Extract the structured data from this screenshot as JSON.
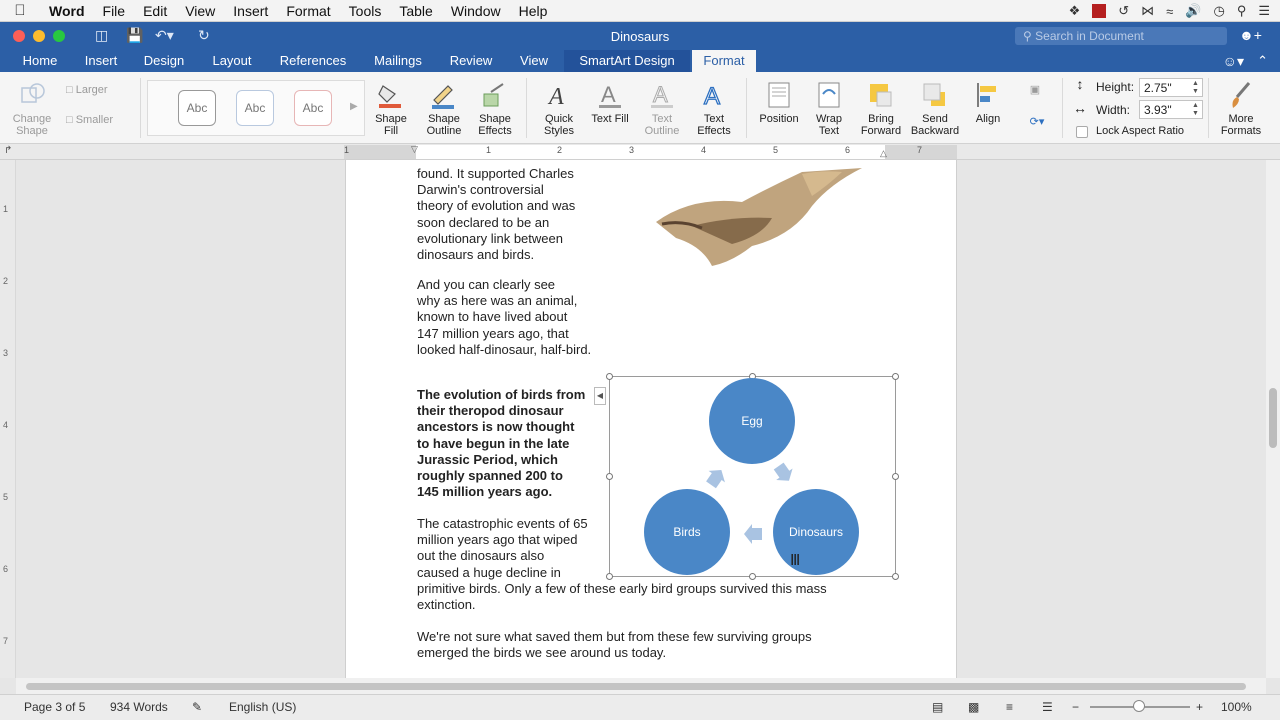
{
  "menubar": {
    "items": [
      "Word",
      "File",
      "Edit",
      "View",
      "Insert",
      "Format",
      "Tools",
      "Table",
      "Window",
      "Help"
    ]
  },
  "window": {
    "title": "Dinosaurs",
    "search_placeholder": "Search in Document"
  },
  "ribbon_tabs": [
    "Home",
    "Insert",
    "Design",
    "Layout",
    "References",
    "Mailings",
    "Review",
    "View",
    "SmartArt Design",
    "Format"
  ],
  "ribbon": {
    "larger": "Larger",
    "smaller": "Smaller",
    "change_shape": "Change Shape",
    "style_sample": "Abc",
    "shape_fill": "Shape Fill",
    "shape_outline": "Shape Outline",
    "shape_effects": "Shape Effects",
    "quick_styles": "Quick Styles",
    "text_fill": "Text Fill",
    "text_outline": "Text Outline",
    "text_effects": "Text Effects",
    "position": "Position",
    "wrap_text": "Wrap Text",
    "bring_forward": "Bring Forward",
    "send_backward": "Send Backward",
    "align": "Align",
    "height_label": "Height:",
    "height_value": "2.75\"",
    "width_label": "Width:",
    "width_value": "3.93\"",
    "lock_aspect": "Lock Aspect Ratio",
    "more_formats": "More Formats"
  },
  "ruler_numbers": [
    "1",
    "1",
    "2",
    "3",
    "4",
    "5",
    "6",
    "7"
  ],
  "vruler_numbers": [
    "1",
    "2",
    "3",
    "4",
    "5",
    "6",
    "7"
  ],
  "document": {
    "para1": "found. It supported Charles\nDarwin's controversial\ntheory of evolution and was\nsoon declared to be an\nevolutionary link between\ndinosaurs and birds.",
    "para2": "And you can clearly see\nwhy as here was an animal,\nknown to have lived about\n147 million years ago, that\nlooked half-dinosaur, half-bird.",
    "para3": "The evolution of birds from\ntheir theropod dinosaur\nancestors is now thought\nto have begun in the late\nJurassic Period, which\nroughly spanned 200 to\n145 million years ago.",
    "para4a": "The catastrophic events of 65\nmillion years ago that wiped\nout the dinosaurs also\ncaused a huge decline in",
    "para4b": "primitive birds. Only a few of these early bird groups survived this mass\nextinction.",
    "para5": "We're not sure what saved them but from these few surviving groups\nemerged the birds we see around us today."
  },
  "smartart": {
    "nodes": [
      "Egg",
      "Dinosaurs",
      "Birds"
    ],
    "color": "#4a87c7"
  },
  "status": {
    "page": "Page 3 of 5",
    "words": "934 Words",
    "language": "English (US)",
    "zoom": "100%",
    "zoom_level": 1.0
  }
}
